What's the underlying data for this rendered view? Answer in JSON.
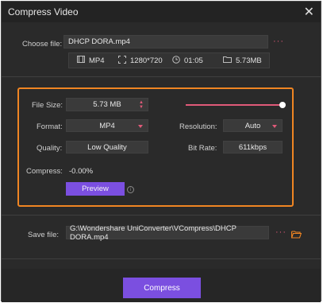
{
  "window": {
    "title": "Compress Video",
    "close_glyph": "✕"
  },
  "file": {
    "label": "Choose file:",
    "value": "DHCP DORA.mp4",
    "more": "···",
    "info": {
      "format": "MP4",
      "resolution": "1280*720",
      "duration": "01:05",
      "size": "5.73MB"
    }
  },
  "settings": {
    "file_size_label": "File Size:",
    "file_size_value": "5.73  MB",
    "format_label": "Format:",
    "format_value": "MP4",
    "resolution_label": "Resolution:",
    "resolution_value": "Auto",
    "quality_label": "Quality:",
    "quality_value": "Low Quality",
    "bitrate_label": "Bit Rate:",
    "bitrate_value": "611kbps",
    "compress_label": "Compress:",
    "compress_value": "-0.00%",
    "preview_label": "Preview",
    "slider_level": 1.0
  },
  "save": {
    "label": "Save file:",
    "path": "G:\\Wondershare UniConverter\\VCompress\\DHCP DORA.mp4",
    "more": "···"
  },
  "compress_button": "Compress",
  "colors": {
    "accent_purple": "#7b4fe0",
    "highlight_orange": "#f08522",
    "pink_accent": "#e05a79",
    "background": "#2a2a2a"
  },
  "icons": {
    "format": "film-icon",
    "resolution": "expand-icon",
    "duration": "clock-icon",
    "size": "folder-icon",
    "save_folder": "open-folder-icon"
  }
}
